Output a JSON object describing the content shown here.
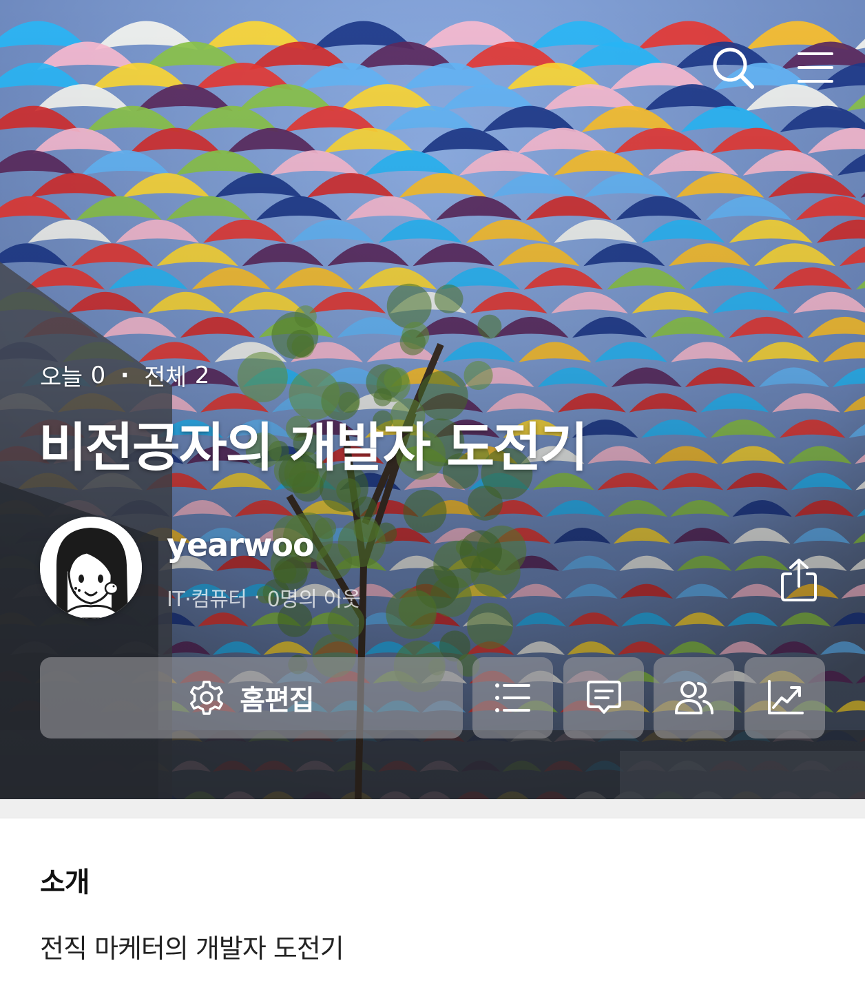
{
  "header": {
    "search_icon": "search-icon",
    "menu_icon": "hamburger-menu-icon"
  },
  "stats": {
    "today_label": "오늘",
    "today_count": "0",
    "separator": "·",
    "total_label": "전체",
    "total_count": "2"
  },
  "blog": {
    "title": "비전공자의 개발자 도전기"
  },
  "profile": {
    "username": "yearwoo",
    "category": "IT·컴퓨터",
    "separator": "·",
    "neighbors": "0명의 이웃"
  },
  "actions": {
    "edit_label": "홈편집",
    "edit_icon": "gear-icon",
    "buttons": [
      {
        "icon": "list-icon"
      },
      {
        "icon": "comment-icon"
      },
      {
        "icon": "neighbors-icon"
      },
      {
        "icon": "stats-chart-icon"
      }
    ],
    "share_icon": "share-icon"
  },
  "intro": {
    "heading": "소개",
    "text": "전직 마케터의 개발자 도전기"
  },
  "colors": {
    "overlay_button": "#96969b",
    "text_white": "#ffffff",
    "divider": "#efefef"
  }
}
